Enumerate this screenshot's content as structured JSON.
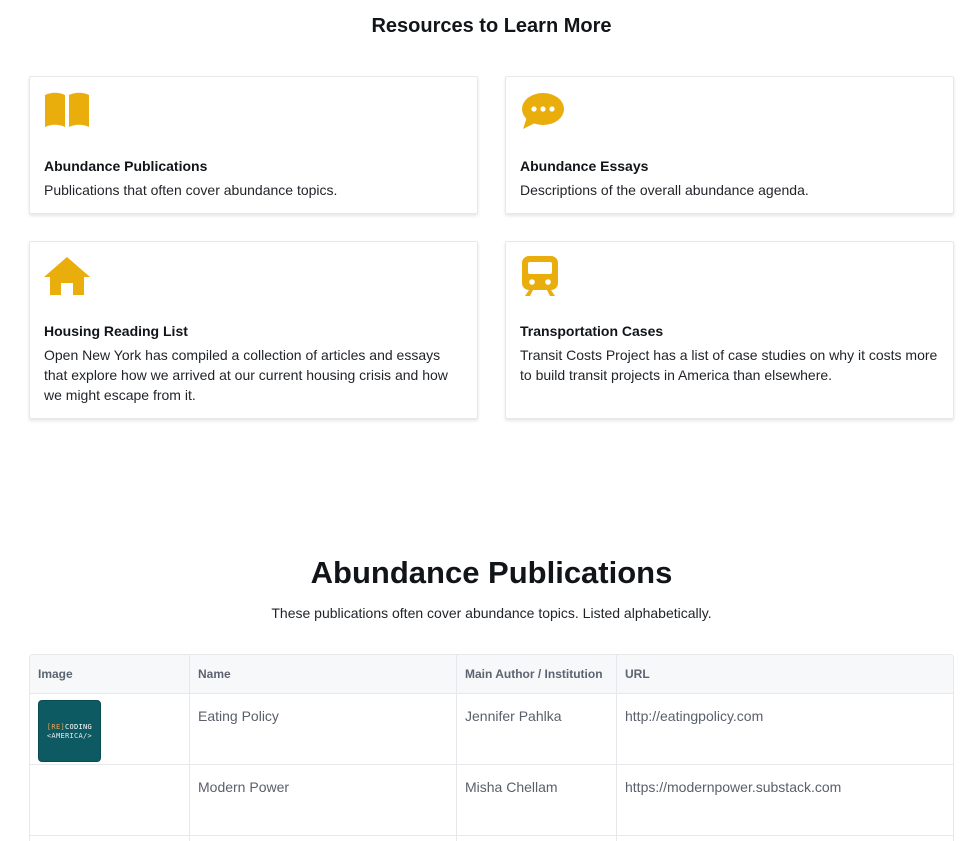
{
  "resources": {
    "title": "Resources to Learn More",
    "accent_color": "#e9ad0c",
    "cards": [
      {
        "icon": "book-icon",
        "title": "Abundance Publications",
        "desc": "Publications that often cover abundance topics."
      },
      {
        "icon": "chat-bubble-icon",
        "title": "Abundance Essays",
        "desc": "Descriptions of the overall abundance agenda."
      },
      {
        "icon": "house-icon",
        "title": "Housing Reading List",
        "desc": "Open New York has compiled a collection of articles and essays that explore how we arrived at our current housing crisis and how we might escape from it."
      },
      {
        "icon": "train-icon",
        "title": "Transportation Cases",
        "desc": "Transit Costs Project has a list of case studies on why it costs more to build transit projects in America than elsewhere."
      }
    ]
  },
  "publications": {
    "title": "Abundance Publications",
    "subtitle": "These publications often cover abundance topics. Listed alphabetically.",
    "columns": [
      "Image",
      "Name",
      "Main Author / Institution",
      "URL"
    ],
    "rows": [
      {
        "has_image": true,
        "image_line1_a": "[RE]",
        "image_line1_b": "CODING",
        "image_line2": "<AMERICA/>",
        "name": "Eating Policy",
        "author": "Jennifer Pahlka",
        "url": "http://eatingpolicy.com"
      },
      {
        "has_image": false,
        "name": "Modern Power",
        "author": "Misha Chellam",
        "url": "https://modernpower.substack.com"
      }
    ]
  }
}
